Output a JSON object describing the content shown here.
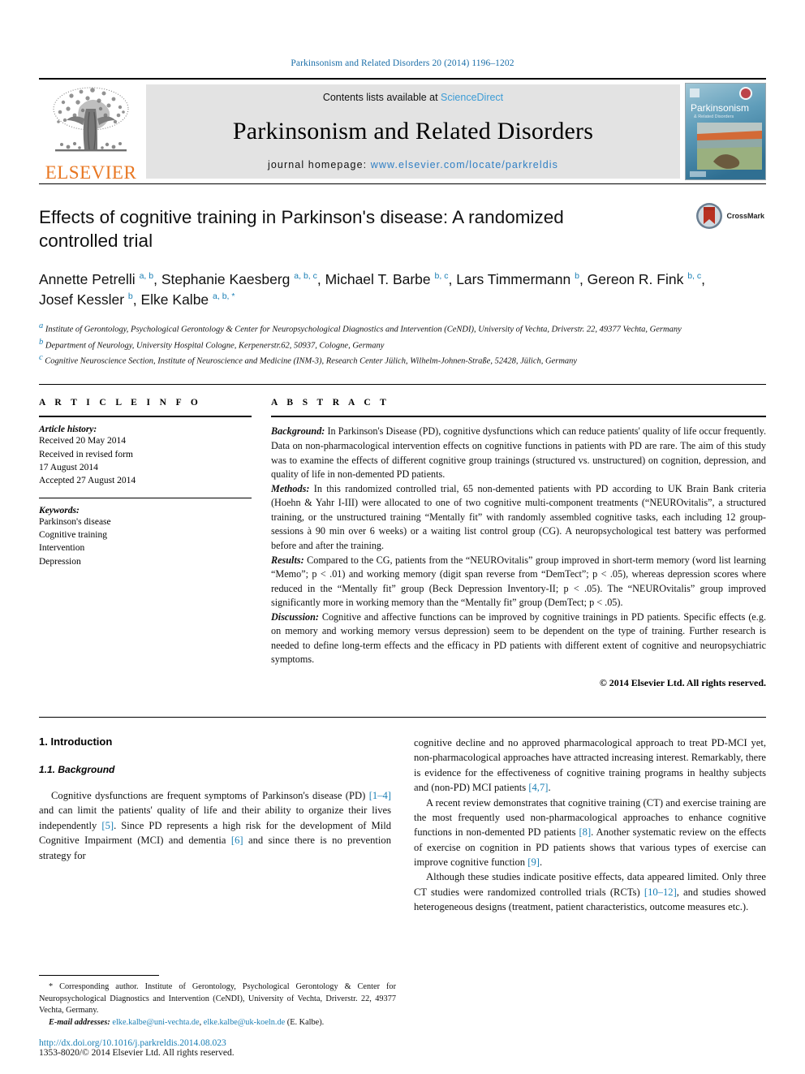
{
  "running_head": "Parkinsonism and Related Disorders 20 (2014) 1196–1202",
  "masthead": {
    "publisher_logo_text": "ELSEVIER",
    "contents_prefix": "Contents lists available at ",
    "contents_link": "ScienceDirect",
    "journal_title": "Parkinsonism and Related Disorders",
    "homepage_prefix": "journal homepage: ",
    "homepage_url": "www.elsevier.com/locate/parkreldis",
    "cover_title": "Parkinsonism",
    "cover_subtitle": "& Related Disorders"
  },
  "article": {
    "title": "Effects of cognitive training in Parkinson's disease: A randomized controlled trial",
    "crossmark_label": "CrossMark",
    "authors_line_1": "Annette Petrelli",
    "authors": [
      {
        "name": "Annette Petrelli",
        "marks": "a, b"
      },
      {
        "name": "Stephanie Kaesberg",
        "marks": "a, b, c"
      },
      {
        "name": "Michael T. Barbe",
        "marks": "b, c"
      },
      {
        "name": "Lars Timmermann",
        "marks": "b"
      },
      {
        "name": "Gereon R. Fink",
        "marks": "b, c"
      },
      {
        "name": "Josef Kessler",
        "marks": "b"
      },
      {
        "name": "Elke Kalbe",
        "marks": "a, b, *"
      }
    ],
    "affiliations": [
      {
        "mark": "a",
        "text": "Institute of Gerontology, Psychological Gerontology & Center for Neuropsychological Diagnostics and Intervention (CeNDI), University of Vechta, Driverstr. 22, 49377 Vechta, Germany"
      },
      {
        "mark": "b",
        "text": "Department of Neurology, University Hospital Cologne, Kerpenerstr.62, 50937, Cologne, Germany"
      },
      {
        "mark": "c",
        "text": "Cognitive Neuroscience Section, Institute of Neuroscience and Medicine (INM-3), Research Center Jülich, Wilhelm-Johnen-Straße, 52428, Jülich, Germany"
      }
    ]
  },
  "article_info": {
    "heading": "A R T I C L E   I N F O",
    "history_label": "Article history:",
    "history": [
      "Received 20 May 2014",
      "Received in revised form",
      "17 August 2014",
      "Accepted 27 August 2014"
    ],
    "keywords_label": "Keywords:",
    "keywords": [
      "Parkinson's disease",
      "Cognitive training",
      "Intervention",
      "Depression"
    ]
  },
  "abstract": {
    "heading": "A B S T R A C T",
    "sections": [
      {
        "lead": "Background:",
        "text": " In Parkinson's Disease (PD), cognitive dysfunctions which can reduce patients' quality of life occur frequently. Data on non-pharmacological intervention effects on cognitive functions in patients with PD are rare. The aim of this study was to examine the effects of different cognitive group trainings (structured vs. unstructured) on cognition, depression, and quality of life in non-demented PD patients."
      },
      {
        "lead": "Methods:",
        "text": " In this randomized controlled trial, 65 non-demented patients with PD according to UK Brain Bank criteria (Hoehn & Yahr I-III) were allocated to one of two cognitive multi-component treatments (“NEUROvitalis”, a structured training, or the unstructured training “Mentally fit” with randomly assembled cognitive tasks, each including 12 group-sessions à 90 min over 6 weeks) or a waiting list control group (CG). A neuropsychological test battery was performed before and after the training."
      },
      {
        "lead": "Results:",
        "text": " Compared to the CG, patients from the “NEUROvitalis” group improved in short-term memory (word list learning “Memo”; p < .01) and working memory (digit span reverse from “DemTect”; p < .05), whereas depression scores where reduced in the “Mentally fit” group (Beck Depression Inventory-II; p < .05). The “NEUROvitalis” group improved significantly more in working memory than the “Mentally fit” group (DemTect; p < .05)."
      },
      {
        "lead": "Discussion:",
        "text": " Cognitive and affective functions can be improved by cognitive trainings in PD patients. Specific effects (e.g. on memory and working memory versus depression) seem to be dependent on the type of training. Further research is needed to define long-term effects and the efficacy in PD patients with different extent of cognitive and neuropsychiatric symptoms."
      }
    ],
    "copyright": "© 2014 Elsevier Ltd. All rights reserved."
  },
  "body": {
    "section_number_title": "1.  Introduction",
    "subsection_number_title": "1.1.  Background",
    "left_paragraphs": [
      "Cognitive dysfunctions are frequent symptoms of Parkinson's disease (PD) [1–4] and can limit the patients' quality of life and their ability to organize their lives independently [5]. Since PD represents a high risk for the development of Mild Cognitive Impairment (MCI) and dementia [6] and since there is no prevention strategy for"
    ],
    "right_paragraphs": [
      "cognitive decline and no approved pharmacological approach to treat PD-MCI yet, non-pharmacological approaches have attracted increasing interest. Remarkably, there is evidence for the effectiveness of cognitive training programs in healthy subjects and (non-PD) MCI patients [4,7].",
      "A recent review demonstrates that cognitive training (CT) and exercise training are the most frequently used non-pharmacological approaches to enhance cognitive functions in non-demented PD patients [8]. Another systematic review on the effects of exercise on cognition in PD patients shows that various types of exercise can improve cognitive function [9].",
      "Although these studies indicate positive effects, data appeared limited. Only three CT studies were randomized controlled trials (RCTs) [10–12], and studies showed heterogeneous designs (treatment, patient characteristics, outcome measures etc.)."
    ]
  },
  "footnote": {
    "corresponding": "* Corresponding author. Institute of Gerontology, Psychological Gerontology & Center for Neuropsychological Diagnostics and Intervention (CeNDI), University of Vechta, Driverstr. 22, 49377 Vechta, Germany.",
    "email_label": "E-mail addresses:",
    "emails": [
      "elke.kalbe@uni-vechta.de",
      "elke.kalbe@uk-koeln.de"
    ],
    "email_suffix": " (E. Kalbe).",
    "doi": "http://dx.doi.org/10.1016/j.parkreldis.2014.08.023",
    "issn": "1353-8020/© 2014 Elsevier Ltd. All rights reserved."
  },
  "colors": {
    "link_blue": "#1a7fb5",
    "sciencedirect_blue": "#3c9cd6",
    "elsevier_orange": "#E87722",
    "crossmark_red": "#b83121"
  }
}
